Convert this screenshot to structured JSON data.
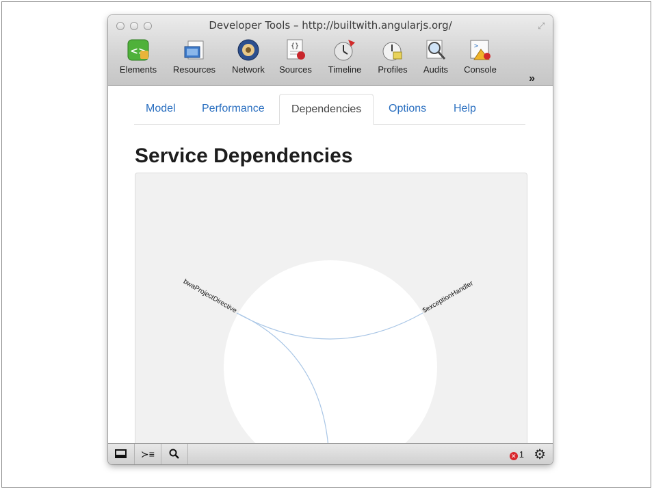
{
  "window": {
    "title": "Developer Tools – http://builtwith.angularjs.org/"
  },
  "toolbar": {
    "items": [
      {
        "label": "Elements",
        "icon": "elements-icon"
      },
      {
        "label": "Resources",
        "icon": "resources-icon"
      },
      {
        "label": "Network",
        "icon": "network-icon"
      },
      {
        "label": "Sources",
        "icon": "sources-icon"
      },
      {
        "label": "Timeline",
        "icon": "timeline-icon"
      },
      {
        "label": "Profiles",
        "icon": "profiles-icon"
      },
      {
        "label": "Audits",
        "icon": "audits-icon"
      },
      {
        "label": "Console",
        "icon": "console-icon"
      }
    ],
    "more": "»"
  },
  "tabs": [
    {
      "label": "Model",
      "active": false
    },
    {
      "label": "Performance",
      "active": false
    },
    {
      "label": "Dependencies",
      "active": true
    },
    {
      "label": "Options",
      "active": false
    },
    {
      "label": "Help",
      "active": false
    }
  ],
  "page": {
    "heading": "Service Dependencies"
  },
  "graph": {
    "nodes": [
      "bwaProjectDirective",
      "$exceptionHandler"
    ],
    "colors": {
      "link": "#a9c6e6",
      "circle": "#ffffff",
      "background": "#f1f1f1"
    }
  },
  "statusbar": {
    "dock_icon": "dock-icon",
    "console_icon": "console-toggle-icon",
    "search_icon": "search-icon",
    "error_count": "1",
    "settings_icon": "gear-icon"
  }
}
